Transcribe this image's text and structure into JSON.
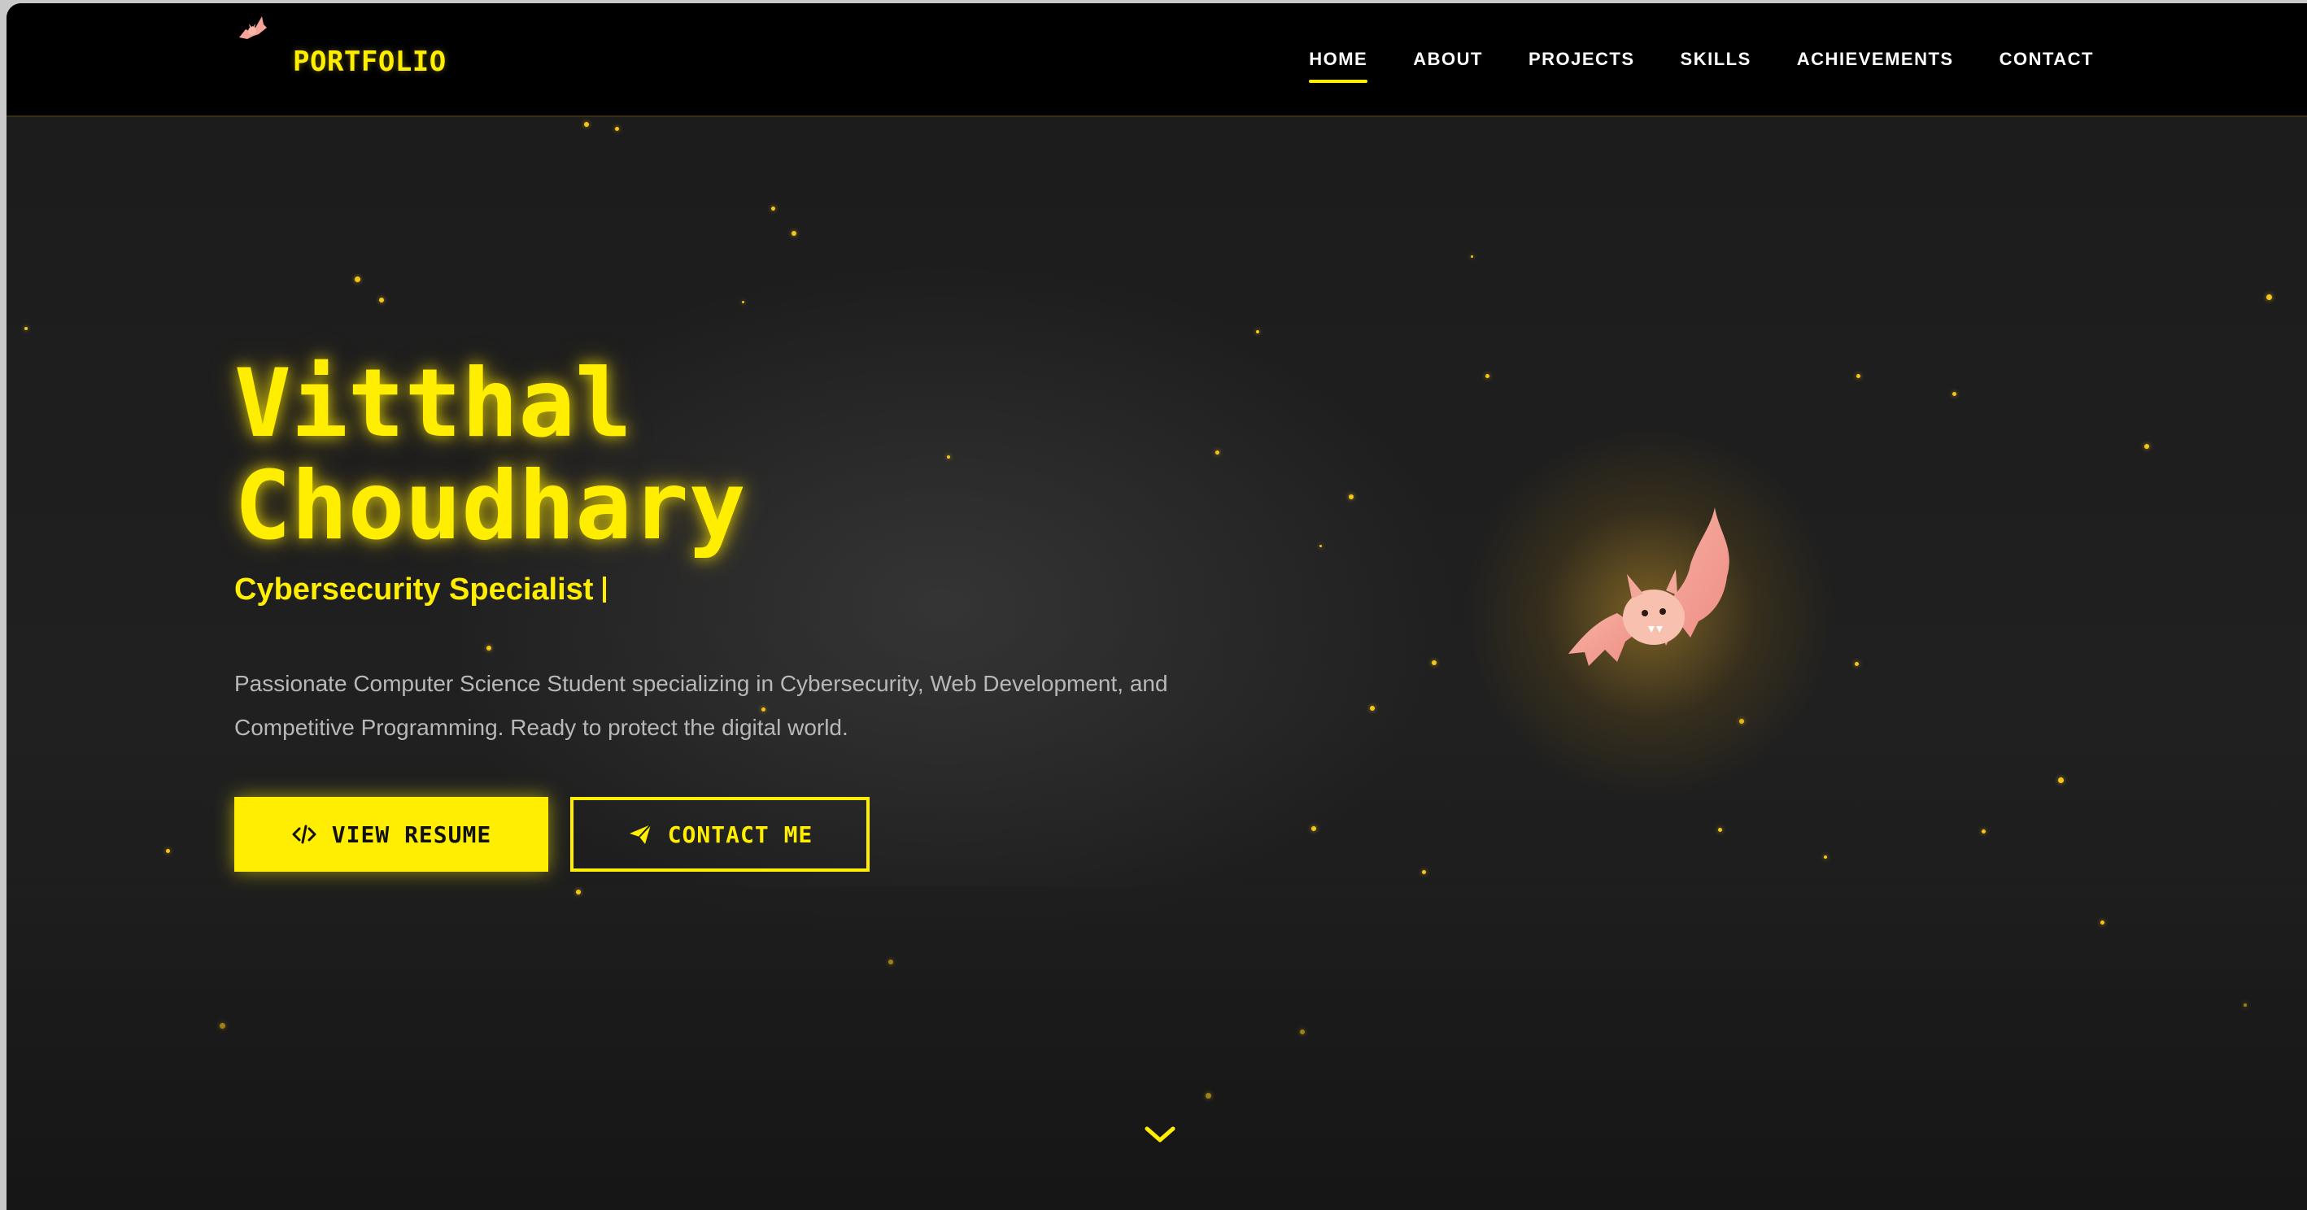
{
  "brand": {
    "logo_text": "PORTFOLIO",
    "logo_icon": "bat-icon",
    "accent_color": "#ffee00"
  },
  "nav": {
    "items": [
      {
        "label": "HOME",
        "active": true
      },
      {
        "label": "ABOUT",
        "active": false
      },
      {
        "label": "PROJECTS",
        "active": false
      },
      {
        "label": "SKILLS",
        "active": false
      },
      {
        "label": "ACHIEVEMENTS",
        "active": false
      },
      {
        "label": "CONTACT",
        "active": false
      }
    ]
  },
  "hero": {
    "name_line1": "Vitthal",
    "name_line2": "Choudhary",
    "subtitle": "Cybersecurity Specialist",
    "description": "Passionate Computer Science Student specializing in Cybersecurity, Web Development, and Competitive Programming. Ready to protect the digital world.",
    "primary_button": {
      "label": "VIEW RESUME",
      "icon": "code-icon"
    },
    "secondary_button": {
      "label": "CONTACT ME",
      "icon": "paper-plane-icon"
    },
    "illustration": "bat-illustration",
    "scroll_icon": "chevron-down-icon"
  }
}
